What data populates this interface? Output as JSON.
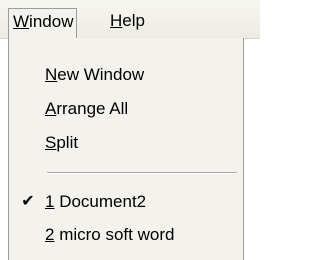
{
  "menubar": {
    "items": [
      {
        "accel": "W",
        "rest": "indow"
      },
      {
        "accel": "H",
        "rest": "elp"
      }
    ]
  },
  "window_menu": {
    "items": [
      {
        "accel": "N",
        "rest": "ew Window",
        "checked": false
      },
      {
        "accel": "A",
        "rest": "rrange All",
        "checked": false
      },
      {
        "accel": "S",
        "rest": "plit",
        "checked": false
      }
    ],
    "documents": [
      {
        "accel": "1",
        "rest": " Document2",
        "checked": true,
        "check_symbol": "✔"
      },
      {
        "accel": "2",
        "rest": " micro soft word",
        "checked": false
      }
    ]
  }
}
